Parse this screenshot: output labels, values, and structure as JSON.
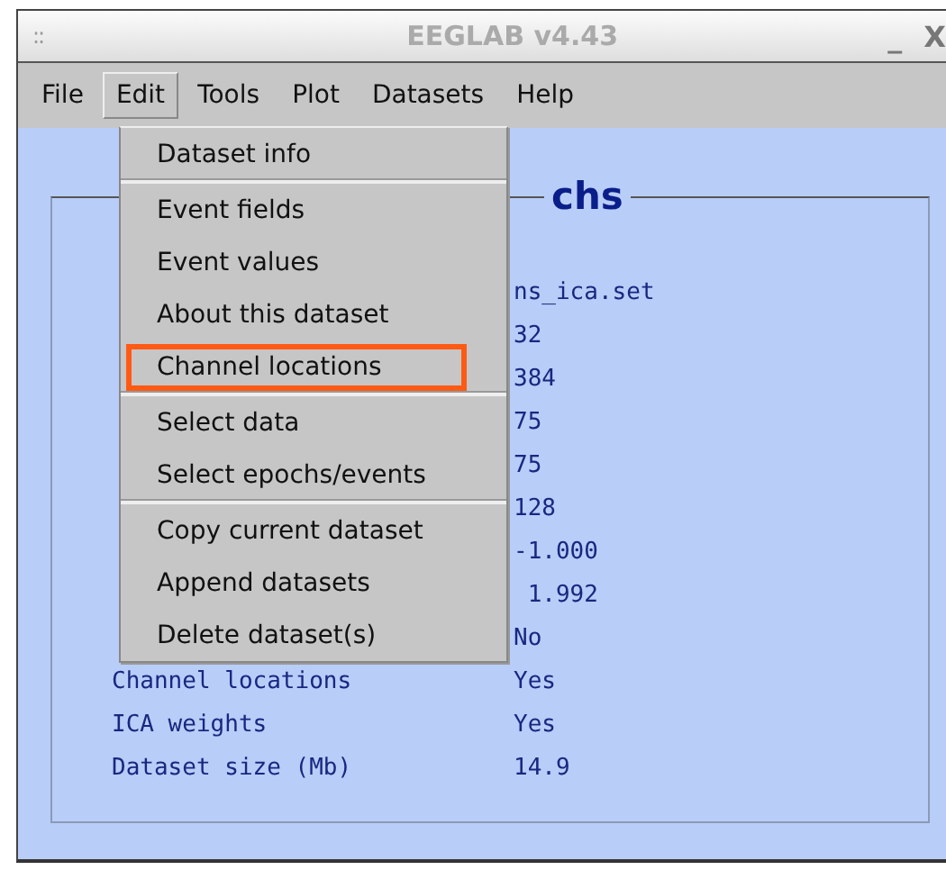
{
  "window": {
    "title": "EEGLAB v4.43",
    "grip": "::",
    "minimize": "_",
    "close": "X"
  },
  "menu_bar": [
    {
      "label": "File",
      "selected": false
    },
    {
      "label": "Edit",
      "selected": true
    },
    {
      "label": "Tools",
      "selected": false
    },
    {
      "label": "Plot",
      "selected": false
    },
    {
      "label": "Datasets",
      "selected": false
    },
    {
      "label": "Help",
      "selected": false
    }
  ],
  "edit_menu": [
    {
      "label": "Dataset info",
      "separator_after": true,
      "highlighted": false
    },
    {
      "label": "Event fields",
      "separator_after": false,
      "highlighted": false
    },
    {
      "label": "Event values",
      "separator_after": false,
      "highlighted": false
    },
    {
      "label": "About this dataset",
      "separator_after": false,
      "highlighted": false
    },
    {
      "label": "Channel locations",
      "separator_after": true,
      "highlighted": true
    },
    {
      "label": "Select data",
      "separator_after": false,
      "highlighted": false
    },
    {
      "label": "Select epochs/events",
      "separator_after": true,
      "highlighted": false
    },
    {
      "label": "Copy current dataset",
      "separator_after": false,
      "highlighted": false
    },
    {
      "label": "Append datasets",
      "separator_after": false,
      "highlighted": false
    },
    {
      "label": "Delete dataset(s)",
      "separator_after": false,
      "highlighted": false
    }
  ],
  "panel": {
    "title": "chs",
    "rows": [
      {
        "value": "ns_ica.set"
      },
      {
        "value": "32"
      },
      {
        "value": "384"
      },
      {
        "value": "75"
      },
      {
        "value": "75"
      },
      {
        "value": "128"
      },
      {
        "value": "-1.000"
      },
      {
        "value": " 1.992"
      },
      {
        "value": "No"
      },
      {
        "label": "Channel locations",
        "value": "Yes"
      },
      {
        "label": "ICA weights",
        "value": "Yes"
      },
      {
        "label": "Dataset size (Mb)",
        "value": "14.9"
      }
    ]
  }
}
